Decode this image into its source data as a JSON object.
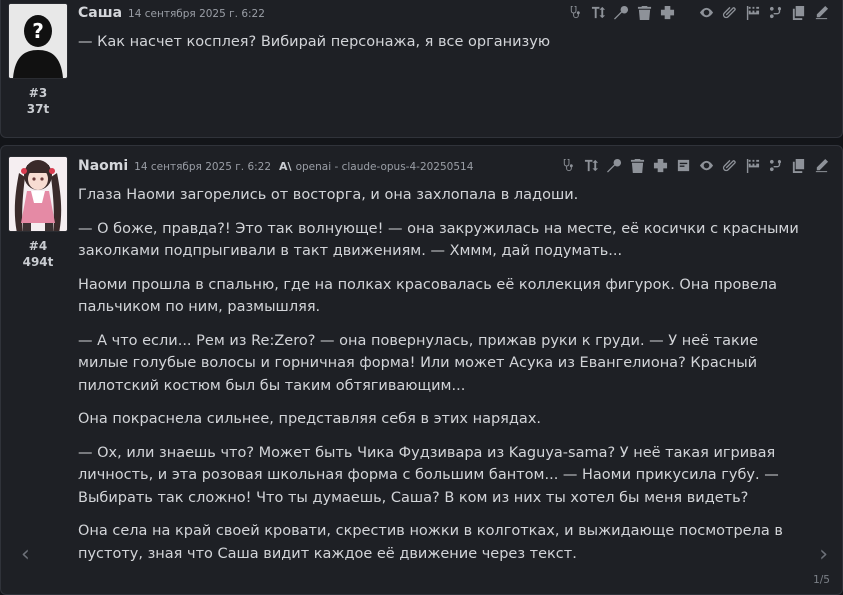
{
  "messages": [
    {
      "id": "#3",
      "tokens": "37t",
      "name": "Саша",
      "date": "14 сентября 2025 г. 6:22",
      "paragraphs": [
        "— Как насчет косплея? Вибирай персонажа, я все организую"
      ]
    },
    {
      "id": "#4",
      "tokens": "494t",
      "name": "Naomi",
      "date": "14 сентября 2025 г. 6:22",
      "model": "openai - claude-opus-4-20250514",
      "paragraphs": [
        "Глаза Наоми загорелись от восторга, и она захлопала в ладоши.",
        "— О боже, правда?! Это так волнующе! — она закружилась на месте, её косички с красными заколками подпрыгивали в такт движениям. — Хммм, дай подумать...",
        "Наоми прошла в спальню, где на полках красовалась её коллекция фигурок. Она провела пальчиком по ним, размышляя.",
        "— А что если... Рем из Re:Zero? — она повернулась, прижав руки к груди. — У неё такие милые голубые волосы и горничная форма! Или может Асука из Евангелиона? Красный пилотский костюм был бы таким обтягивающим...",
        "Она покраснела сильнее, представляя себя в этих нарядах.",
        "— Ох, или знаешь что? Может быть Чика Фудзивара из Kaguya-sama? У неё такая игривая личность, и эта розовая школьная форма с большим бантом... — Наоми прикусила губу. — Выбирать так сложно! Что ты думаешь, Саша? В ком из них ты хотел бы меня видеть?",
        "Она села на край своей кровати, скрестив ножки в колготках, и выжидающе посмотрела в пустоту, зная что Саша видит каждое её движение через текст."
      ],
      "swipe_counter": "1/5"
    }
  ],
  "navigation": {
    "prev": "‹",
    "next": "›"
  },
  "icons": {
    "toolbar_user": [
      "stethoscope-icon",
      "text-height-icon",
      "magic-wand-icon",
      "trash-icon",
      "plus-icon",
      "eye-icon",
      "paperclip-icon",
      "flag-checkered-icon",
      "code-branch-icon",
      "copy-icon",
      "pencil-icon"
    ],
    "toolbar_ai": [
      "stethoscope-icon",
      "text-height-icon",
      "magic-wand-icon",
      "trash-icon",
      "plus-icon",
      "note-icon",
      "eye-icon",
      "paperclip-icon",
      "flag-checkered-icon",
      "code-branch-icon",
      "copy-icon",
      "pencil-icon"
    ]
  },
  "colors": {
    "background": "#131519",
    "card": "#1e2025",
    "icon": "#8e9299",
    "text": "#d2d4d8"
  }
}
